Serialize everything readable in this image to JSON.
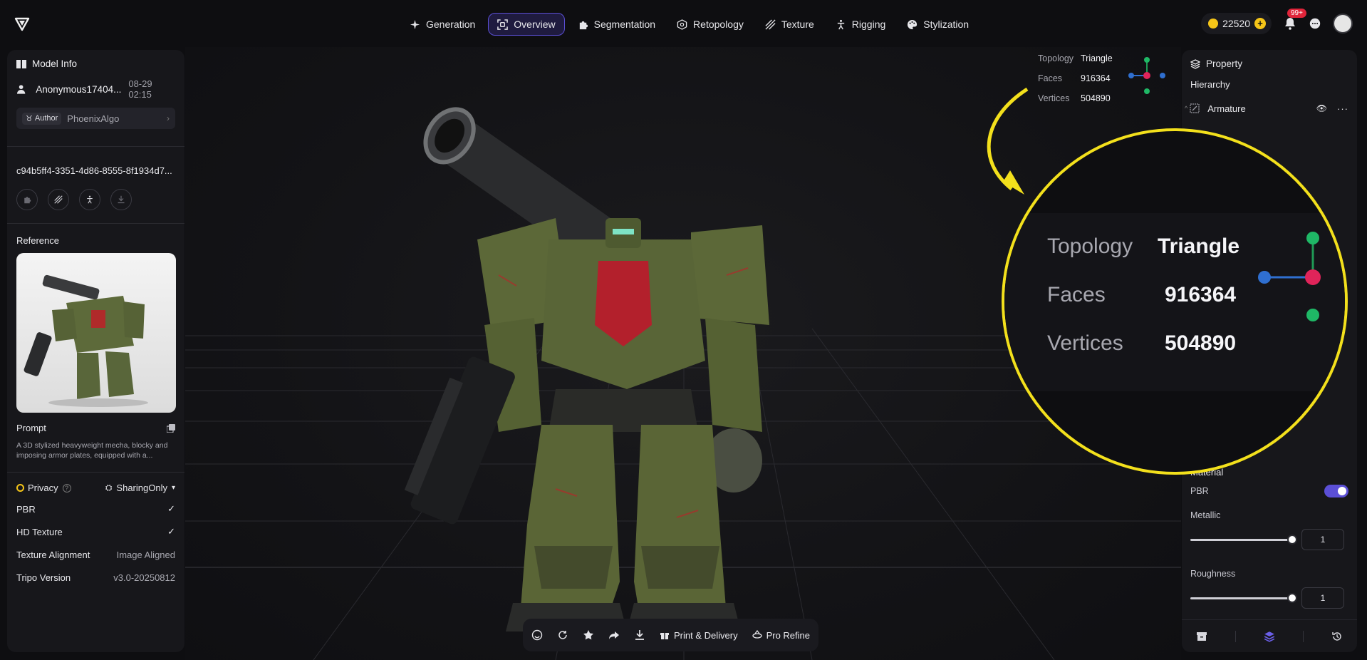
{
  "nav": {
    "items": [
      {
        "label": "Generation",
        "icon": "sparkle-icon"
      },
      {
        "label": "Overview",
        "icon": "scan-icon"
      },
      {
        "label": "Segmentation",
        "icon": "puzzle-icon"
      },
      {
        "label": "Retopology",
        "icon": "mesh-icon"
      },
      {
        "label": "Texture",
        "icon": "stripes-icon"
      },
      {
        "label": "Rigging",
        "icon": "figure-icon"
      },
      {
        "label": "Stylization",
        "icon": "palette-icon"
      }
    ],
    "active": "Overview"
  },
  "header": {
    "credits": "22520",
    "notification_badge": "99+"
  },
  "left_panel": {
    "title": "Model Info",
    "username": "Anonymous17404...",
    "date": "08-29 02:15",
    "author_tag": "Author",
    "author_name": "PhoenixAlgo",
    "uuid": "c94b5ff4-3351-4d86-8555-8f1934d7...",
    "reference_label": "Reference",
    "prompt_label": "Prompt",
    "prompt_text": "A 3D stylized heavyweight mecha, blocky and imposing armor plates, equipped with a...",
    "privacy_label": "Privacy",
    "privacy_value": "SharingOnly",
    "props": [
      {
        "key": "PBR",
        "value": "✓"
      },
      {
        "key": "HD Texture",
        "value": "✓"
      },
      {
        "key": "Texture Alignment",
        "value": "Image Aligned"
      },
      {
        "key": "Tripo Version",
        "value": "v3.0-20250812"
      }
    ]
  },
  "topology": {
    "rows": [
      {
        "key": "Topology",
        "value": "Triangle"
      },
      {
        "key": "Faces",
        "value": "916364"
      },
      {
        "key": "Vertices",
        "value": "504890"
      }
    ]
  },
  "right_panel": {
    "title": "Property",
    "hierarchy_label": "Hierarchy",
    "armature_label": "Armature",
    "material_label": "Material",
    "pbr_label": "PBR",
    "pbr_enabled": true,
    "metallic_label": "Metallic",
    "metallic_value": "1",
    "roughness_label": "Roughness",
    "roughness_value": "1"
  },
  "bottom_bar": {
    "print_label": "Print & Delivery",
    "refine_label": "Pro Refine"
  },
  "colors": {
    "accent": "#5b4fd6",
    "highlight_ring": "#f3e01c",
    "credit_coin": "#f5c518",
    "badge_red": "#e0243a"
  }
}
